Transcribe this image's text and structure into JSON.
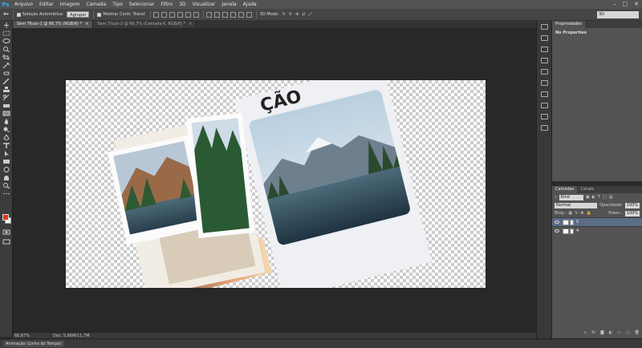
{
  "app": {
    "logo": "Ps"
  },
  "menu": [
    "Arquivo",
    "Editar",
    "Imagem",
    "Camada",
    "Tipo",
    "Selecionar",
    "Filtro",
    "3D",
    "Visualizar",
    "Janela",
    "Ajuda"
  ],
  "options_bar": {
    "auto_select_label": "Seleção Automática:",
    "auto_select_value": "Agrupar",
    "transform_label": "Mostrar Contr. Transf.",
    "mode_3d_label": "3D Modo:",
    "workspace_value": "3D"
  },
  "tabs": [
    {
      "label": "Sem Título-1 @ 66,7% (RGB/8) *",
      "active": true
    },
    {
      "label": "Sem Título-2 @ 66,7% (Camada 6, RGB/8) *",
      "active": false
    }
  ],
  "canvas": {
    "poster_text": "ÇÃO"
  },
  "status": {
    "zoom": "66,67%",
    "doc": "Doc: 5,66M/11,7M"
  },
  "bottom_tab": "Animação (Linha do Tempo)",
  "properties": {
    "tab": "Propriedades",
    "empty_label": "No Properties"
  },
  "layers_panel": {
    "tabs": [
      "Camadas",
      "Canais"
    ],
    "kind_label": "Kind",
    "blend_mode": "Normal",
    "opacity_label": "Opacidade:",
    "opacity_value": "100%",
    "lock_label": "Bloq.:",
    "fill_label": "Preen.:",
    "fill_value": "100%",
    "layers": [
      {
        "name": "5",
        "selected": true
      },
      {
        "name": "4",
        "selected": false
      }
    ]
  },
  "colors": {
    "foreground": "#e03a1e",
    "background": "#ffffff",
    "accent": "#31a8ff",
    "selected_layer": "#5b6c87"
  }
}
